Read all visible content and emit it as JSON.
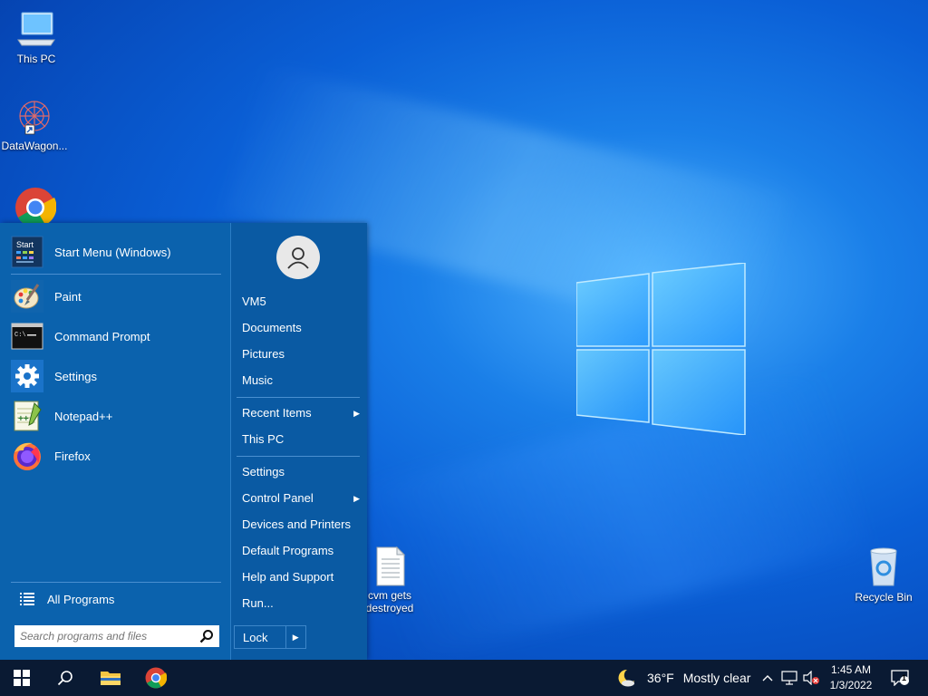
{
  "desktop": {
    "icons": [
      {
        "label": "This PC"
      },
      {
        "label": "DataWagon..."
      },
      {
        "label": "cvm gets destroyed"
      },
      {
        "label": "Recycle Bin"
      }
    ]
  },
  "start_menu": {
    "header_item": {
      "label": "Start Menu (Windows)"
    },
    "pinned": [
      {
        "label": "Paint",
        "icon": "paint-icon"
      },
      {
        "label": "Command Prompt",
        "icon": "command-prompt-icon"
      },
      {
        "label": "Settings",
        "icon": "settings-gear-icon"
      },
      {
        "label": "Notepad++",
        "icon": "notepad-plus-plus-icon"
      },
      {
        "label": "Firefox",
        "icon": "firefox-icon"
      }
    ],
    "all_programs": "All Programs",
    "search_placeholder": "Search programs and files",
    "right": {
      "user": "VM5",
      "items": [
        {
          "label": "Documents"
        },
        {
          "label": "Pictures"
        },
        {
          "label": "Music"
        },
        {
          "label": "Recent Items"
        },
        {
          "label": "This PC"
        },
        {
          "label": "Settings"
        },
        {
          "label": "Control Panel"
        },
        {
          "label": "Devices and Printers"
        },
        {
          "label": "Default Programs"
        },
        {
          "label": "Help and Support"
        },
        {
          "label": "Run..."
        }
      ],
      "lock": "Lock"
    }
  },
  "taskbar": {
    "weather_temp": "36°F",
    "weather_desc": "Mostly clear",
    "time": "1:45 AM",
    "date": "1/3/2022",
    "notification_count": "1"
  },
  "colors": {
    "accent": "#0b62ad",
    "taskbar": "#0a1a33"
  }
}
